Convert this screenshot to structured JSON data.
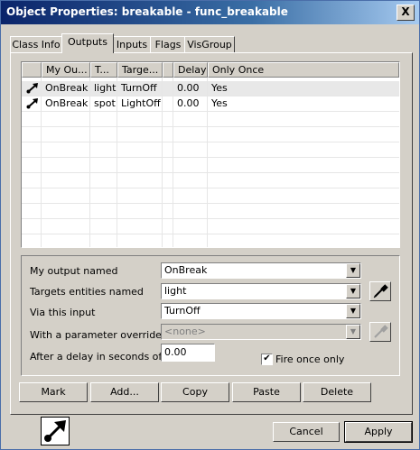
{
  "window": {
    "title": "Object Properties: breakable - func_breakable",
    "close_label": "X"
  },
  "tabs": [
    {
      "label": "Class Info"
    },
    {
      "label": "Outputs"
    },
    {
      "label": "Inputs"
    },
    {
      "label": "Flags"
    },
    {
      "label": "VisGroup"
    }
  ],
  "list": {
    "columns": [
      "My Ou...",
      "T...",
      "Targe...",
      "",
      "Delay",
      "Only Once"
    ],
    "rows": [
      {
        "output": "OnBreak",
        "target": "light",
        "input": "TurnOff",
        "delay": "0.00",
        "only_once": "Yes",
        "icon": "output-arrow-icon"
      },
      {
        "output": "OnBreak",
        "target": "spot",
        "input": "LightOff",
        "delay": "0.00",
        "only_once": "Yes",
        "icon": "output-arrow-icon"
      }
    ]
  },
  "form": {
    "output_label": "My output named",
    "output_value": "OnBreak",
    "targets_label": "Targets entities named",
    "targets_value": "light",
    "input_label": "Via this input",
    "input_value": "TurnOff",
    "param_label": "With a parameter override of",
    "param_value": "<none>",
    "delay_label": "After a delay in seconds of",
    "delay_value": "0.00",
    "fire_once_label": "Fire once only",
    "fire_once_checked": true,
    "checkmark": "✔"
  },
  "buttons": {
    "mark": "Mark",
    "add": "Add...",
    "copy": "Copy",
    "paste": "Paste",
    "delete": "Delete",
    "cancel": "Cancel",
    "apply": "Apply"
  },
  "icons": {
    "dropdown_arrow": "▼"
  }
}
